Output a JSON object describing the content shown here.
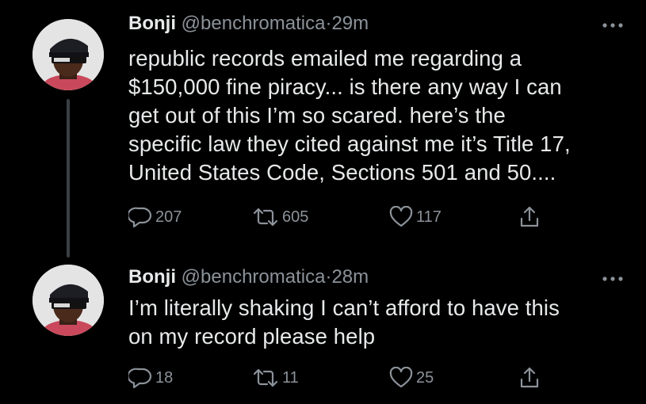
{
  "colors": {
    "background": "#000000",
    "text": "#e7e9ea",
    "secondary": "#8b9299",
    "thread_line": "#3a3f44"
  },
  "tweets": [
    {
      "display_name": "Bonji",
      "handle": "@benchromatica",
      "separator": "·",
      "time": "29m",
      "text_lines": [
        "republic records emailed me regarding a",
        "$150,000 fine piracy... is there any way I can",
        "get out of this I’m so scared. here’s the",
        "specific law they cited against me it’s Title 17,",
        "United States Code, Sections 501 and 50...."
      ],
      "replies": "207",
      "retweets": "605",
      "likes": "117",
      "icons": [
        "reply-icon",
        "retweet-icon",
        "like-icon",
        "share-icon",
        "more-icon"
      ]
    },
    {
      "display_name": "Bonji",
      "handle": "@benchromatica",
      "separator": "·",
      "time": "28m",
      "text_lines": [
        "I’m literally shaking I can’t afford to have this",
        "on my record please help"
      ],
      "replies": "18",
      "retweets": "11",
      "likes": "25",
      "icons": [
        "reply-icon",
        "retweet-icon",
        "like-icon",
        "share-icon",
        "more-icon"
      ]
    }
  ]
}
